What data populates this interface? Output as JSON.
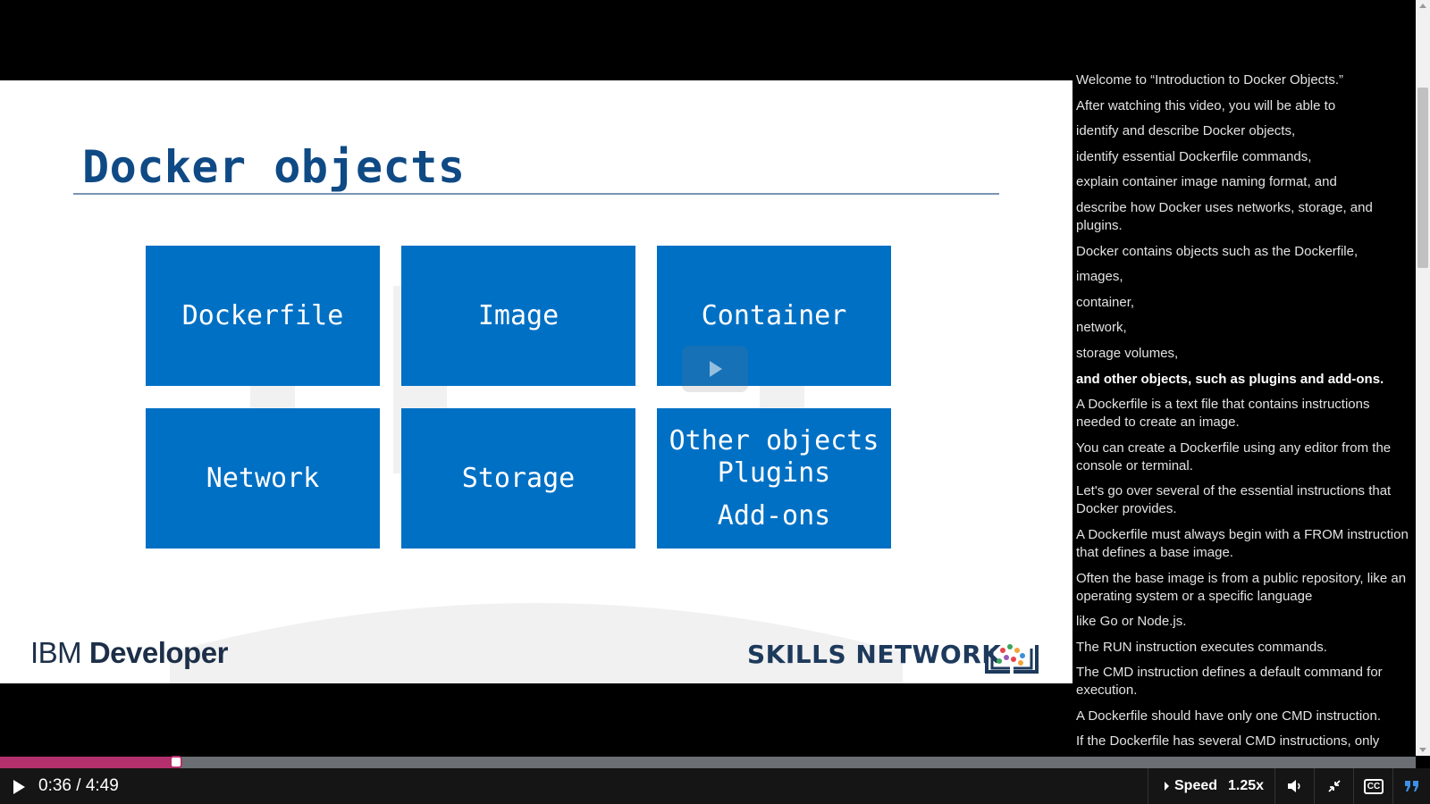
{
  "slide": {
    "title": "Docker objects",
    "tiles": [
      {
        "lines": [
          "Dockerfile"
        ]
      },
      {
        "lines": [
          "Image"
        ]
      },
      {
        "lines": [
          "Container"
        ]
      },
      {
        "lines": [
          "Network"
        ]
      },
      {
        "lines": [
          "Storage"
        ]
      },
      {
        "lines": [
          "Other objects",
          "Plugins",
          "Add-ons"
        ]
      }
    ],
    "brand_left_light": "IBM ",
    "brand_left_bold": "Developer",
    "brand_right": "SKILLS NETWORK",
    "tile_color": "#0070c4",
    "title_color": "#0f4a85"
  },
  "transcript": {
    "active_index": 10,
    "lines": [
      "Welcome to “Introduction to Docker Objects.”",
      "After watching this video, you will be able to",
      "identify and describe Docker objects,",
      "identify essential Dockerfile commands,",
      "explain container image naming format, and",
      "describe how Docker uses networks, storage, and plugins.",
      "Docker contains objects such as the Dockerfile,",
      "images,",
      "container,",
      "network,",
      "storage volumes,",
      "and other objects, such as plugins and add-ons.",
      "A Dockerfile is a text file that contains instructions needed to create an image.",
      "You can create a Dockerfile using any editor from the console or terminal.",
      "Let's go over several of the essential instructions that Docker provides.",
      "A Dockerfile must always begin with a FROM instruction that defines a base image.",
      "Often the base image is from a public repository, like an operating system or a specific language",
      "like Go or Node.js.",
      "The RUN instruction executes commands.",
      "The CMD instruction defines a default command for execution.",
      "A Dockerfile should have only one CMD instruction.",
      "If the Dockerfile has several CMD instructions, only"
    ]
  },
  "player": {
    "current_time": "0:36",
    "separator": " / ",
    "duration": "4:49",
    "progress_fraction": 0.1246,
    "speed_label": "Speed",
    "speed_value": "1.25x",
    "accent_color": "#b4306d",
    "icons": {
      "play": "play-icon",
      "volume": "volume-icon",
      "fullscreen": "exit-fullscreen-icon",
      "captions": "closed-captions-icon",
      "transcript": "transcript-quote-icon"
    }
  }
}
